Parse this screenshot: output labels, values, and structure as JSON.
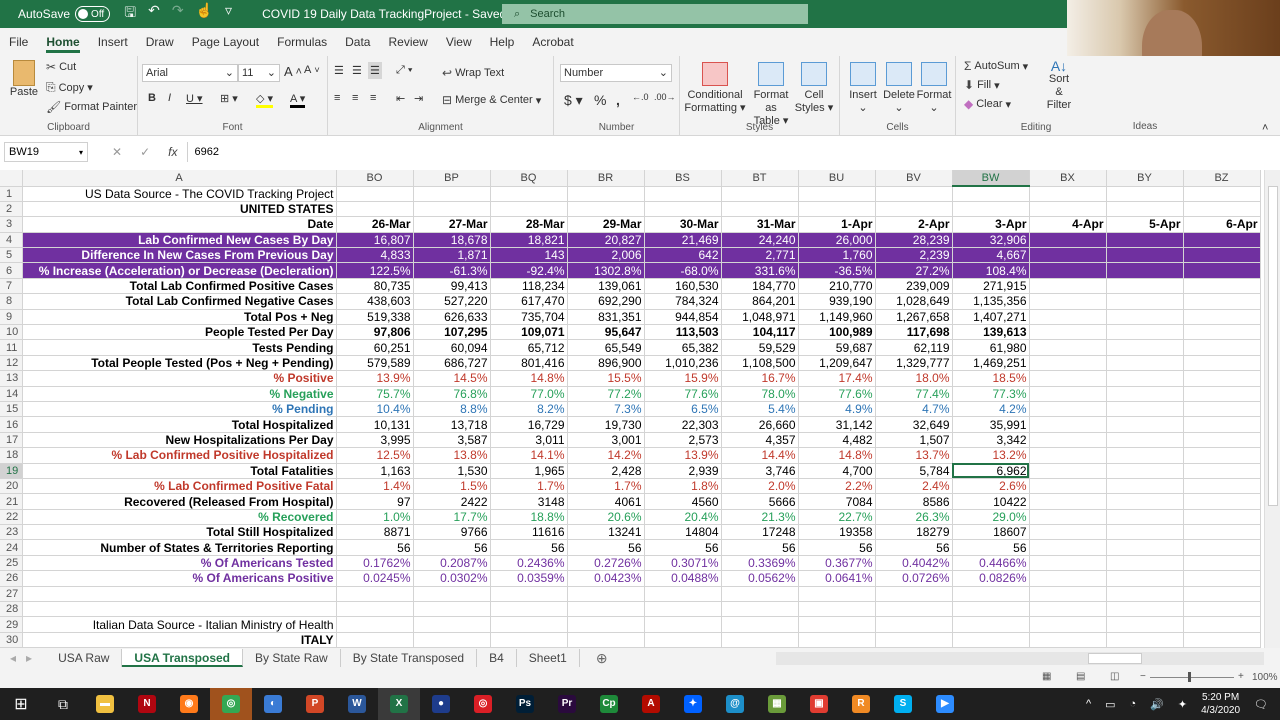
{
  "titlebar": {
    "autosave_label": "AutoSave",
    "autosave_state": "Off",
    "document_title": "COVID 19 Daily Data TrackingProject",
    "save_status": "Saved",
    "search_placeholder": "Search"
  },
  "menu": [
    "File",
    "Home",
    "Insert",
    "Draw",
    "Page Layout",
    "Formulas",
    "Data",
    "Review",
    "View",
    "Help",
    "Acrobat"
  ],
  "menu_active": "Home",
  "ribbon": {
    "clipboard": {
      "paste": "Paste",
      "cut": "Cut",
      "copy": "Copy",
      "format_painter": "Format Painter",
      "label": "Clipboard"
    },
    "font": {
      "name": "Arial",
      "size": "11",
      "label": "Font"
    },
    "alignment": {
      "wrap_text": "Wrap Text",
      "merge_center": "Merge & Center",
      "label": "Alignment"
    },
    "number": {
      "format": "Number",
      "label": "Number"
    },
    "styles": {
      "conditional": "Conditional",
      "conditional2": "Formatting",
      "format_as": "Format as",
      "table": "Table",
      "cell": "Cell",
      "styles": "Styles",
      "label": "Styles"
    },
    "cells": {
      "insert": "Insert",
      "delete": "Delete",
      "format": "Format",
      "label": "Cells"
    },
    "editing": {
      "autosum": "AutoSum",
      "fill": "Fill",
      "clear": "Clear",
      "sort": "Sort &",
      "filter": "Filter",
      "label": "Editing"
    },
    "ideas": {
      "label": "Ideas"
    }
  },
  "formula_bar": {
    "name_box": "BW19",
    "formula": "6962"
  },
  "columns": [
    "A",
    "BO",
    "BP",
    "BQ",
    "BR",
    "BS",
    "BT",
    "BU",
    "BV",
    "BW",
    "BX",
    "BY",
    "BZ"
  ],
  "selected_column": "BW",
  "selected_row": 19,
  "rows": [
    {
      "n": 1,
      "label": "US Data Source - The COVID Tracking Project",
      "style": "plain",
      "values": []
    },
    {
      "n": 2,
      "label": "UNITED STATES",
      "style": "bold",
      "values": []
    },
    {
      "n": 3,
      "label": "Date",
      "style": "bold",
      "values": [
        "26-Mar",
        "27-Mar",
        "28-Mar",
        "29-Mar",
        "30-Mar",
        "31-Mar",
        "1-Apr",
        "2-Apr",
        "3-Apr",
        "4-Apr",
        "5-Apr",
        "6-Apr"
      ]
    },
    {
      "n": 4,
      "label": "Lab Confirmed New Cases By Day",
      "style": "purple",
      "values": [
        "16,807",
        "18,678",
        "18,821",
        "20,827",
        "21,469",
        "24,240",
        "26,000",
        "28,239",
        "32,906",
        "",
        "",
        ""
      ]
    },
    {
      "n": 5,
      "label": "Difference In New Cases From Previous Day",
      "style": "purple",
      "values": [
        "4,833",
        "1,871",
        "143",
        "2,006",
        "642",
        "2,771",
        "1,760",
        "2,239",
        "4,667",
        "",
        "",
        ""
      ]
    },
    {
      "n": 6,
      "label": "% Increase (Acceleration) or Decrease (Decleration)",
      "style": "purple",
      "values": [
        "122.5%",
        "-61.3%",
        "-92.4%",
        "1302.8%",
        "-68.0%",
        "331.6%",
        "-36.5%",
        "27.2%",
        "108.4%",
        "",
        "",
        ""
      ]
    },
    {
      "n": 7,
      "label": "Total Lab Confirmed Positive Cases",
      "style": "black",
      "values": [
        "80,735",
        "99,413",
        "118,234",
        "139,061",
        "160,530",
        "184,770",
        "210,770",
        "239,009",
        "271,915"
      ]
    },
    {
      "n": 8,
      "label": "Total Lab Confirmed Negative Cases",
      "style": "black",
      "values": [
        "438,603",
        "527,220",
        "617,470",
        "692,290",
        "784,324",
        "864,201",
        "939,190",
        "1,028,649",
        "1,135,356"
      ]
    },
    {
      "n": 9,
      "label": "Total Pos + Neg",
      "style": "black",
      "values": [
        "519,338",
        "626,633",
        "735,704",
        "831,351",
        "944,854",
        "1,048,971",
        "1,149,960",
        "1,267,658",
        "1,407,271"
      ]
    },
    {
      "n": 10,
      "label": "People Tested Per Day",
      "style": "boldvals",
      "values": [
        "97,806",
        "107,295",
        "109,071",
        "95,647",
        "113,503",
        "104,117",
        "100,989",
        "117,698",
        "139,613"
      ]
    },
    {
      "n": 11,
      "label": "Tests Pending",
      "style": "black",
      "values": [
        "60,251",
        "60,094",
        "65,712",
        "65,549",
        "65,382",
        "59,529",
        "59,687",
        "62,119",
        "61,980"
      ]
    },
    {
      "n": 12,
      "label": "Total People Tested (Pos + Neg + Pending)",
      "style": "black",
      "values": [
        "579,589",
        "686,727",
        "801,416",
        "896,900",
        "1,010,236",
        "1,108,500",
        "1,209,647",
        "1,329,777",
        "1,469,251"
      ]
    },
    {
      "n": 13,
      "label": "% Positive",
      "style": "red",
      "values": [
        "13.9%",
        "14.5%",
        "14.8%",
        "15.5%",
        "15.9%",
        "16.7%",
        "17.4%",
        "18.0%",
        "18.5%"
      ]
    },
    {
      "n": 14,
      "label": "% Negative",
      "style": "green",
      "values": [
        "75.7%",
        "76.8%",
        "77.0%",
        "77.2%",
        "77.6%",
        "78.0%",
        "77.6%",
        "77.4%",
        "77.3%"
      ]
    },
    {
      "n": 15,
      "label": "% Pending",
      "style": "blue",
      "values": [
        "10.4%",
        "8.8%",
        "8.2%",
        "7.3%",
        "6.5%",
        "5.4%",
        "4.9%",
        "4.7%",
        "4.2%"
      ]
    },
    {
      "n": 16,
      "label": "Total Hospitalized",
      "style": "black",
      "values": [
        "10,131",
        "13,718",
        "16,729",
        "19,730",
        "22,303",
        "26,660",
        "31,142",
        "32,649",
        "35,991"
      ]
    },
    {
      "n": 17,
      "label": "New Hospitalizations Per Day",
      "style": "black",
      "values": [
        "3,995",
        "3,587",
        "3,011",
        "3,001",
        "2,573",
        "4,357",
        "4,482",
        "1,507",
        "3,342"
      ]
    },
    {
      "n": 18,
      "label": "% Lab Confirmed Positive Hospitalized",
      "style": "red",
      "values": [
        "12.5%",
        "13.8%",
        "14.1%",
        "14.2%",
        "13.9%",
        "14.4%",
        "14.8%",
        "13.7%",
        "13.2%"
      ]
    },
    {
      "n": 19,
      "label": "Total Fatalities",
      "style": "black",
      "values": [
        "1,163",
        "1,530",
        "1,965",
        "2,428",
        "2,939",
        "3,746",
        "4,700",
        "5,784",
        "6,962"
      ]
    },
    {
      "n": 20,
      "label": "% Lab Confirmed Positive Fatal",
      "style": "red",
      "values": [
        "1.4%",
        "1.5%",
        "1.7%",
        "1.7%",
        "1.8%",
        "2.0%",
        "2.2%",
        "2.4%",
        "2.6%"
      ]
    },
    {
      "n": 21,
      "label": "Recovered (Released From Hospital)",
      "style": "black",
      "values": [
        "97",
        "2422",
        "3148",
        "4061",
        "4560",
        "5666",
        "7084",
        "8586",
        "10422"
      ]
    },
    {
      "n": 22,
      "label": "% Recovered",
      "style": "green",
      "values": [
        "1.0%",
        "17.7%",
        "18.8%",
        "20.6%",
        "20.4%",
        "21.3%",
        "22.7%",
        "26.3%",
        "29.0%"
      ]
    },
    {
      "n": 23,
      "label": "Total Still Hospitalized",
      "style": "black",
      "values": [
        "8871",
        "9766",
        "11616",
        "13241",
        "14804",
        "17248",
        "19358",
        "18279",
        "18607"
      ]
    },
    {
      "n": 24,
      "label": "Number of States & Territories Reporting",
      "style": "black",
      "values": [
        "56",
        "56",
        "56",
        "56",
        "56",
        "56",
        "56",
        "56",
        "56"
      ]
    },
    {
      "n": 25,
      "label": "% Of Americans Tested",
      "style": "purpletext",
      "values": [
        "0.1762%",
        "0.2087%",
        "0.2436%",
        "0.2726%",
        "0.3071%",
        "0.3369%",
        "0.3677%",
        "0.4042%",
        "0.4466%"
      ]
    },
    {
      "n": 26,
      "label": "% Of Americans Positive",
      "style": "purpletext",
      "values": [
        "0.0245%",
        "0.0302%",
        "0.0359%",
        "0.0423%",
        "0.0488%",
        "0.0562%",
        "0.0641%",
        "0.0726%",
        "0.0826%"
      ]
    },
    {
      "n": 27,
      "label": "",
      "style": "plain",
      "values": []
    },
    {
      "n": 28,
      "label": "",
      "style": "plain",
      "values": []
    },
    {
      "n": 29,
      "label": "Italian Data Source - Italian Ministry of Health",
      "style": "plain",
      "values": []
    },
    {
      "n": 30,
      "label": "ITALY",
      "style": "bold",
      "values": []
    }
  ],
  "sheet_tabs": [
    "USA Raw",
    "USA Transposed",
    "By State Raw",
    "By State Transposed",
    "B4",
    "Sheet1"
  ],
  "active_sheet": "USA Transposed",
  "statusbar": {
    "zoom": "100%"
  },
  "taskbar": {
    "apps": [
      {
        "name": "file-explorer",
        "glyph": "▬",
        "color": "#f0c040"
      },
      {
        "name": "netflix",
        "glyph": "N",
        "color": "#b00610"
      },
      {
        "name": "firefox",
        "glyph": "◉",
        "color": "#ff7a1a"
      },
      {
        "name": "chrome",
        "glyph": "◎",
        "color": "#34a853"
      },
      {
        "name": "browser",
        "glyph": "◐",
        "color": "#3a7bd5"
      },
      {
        "name": "powerpoint",
        "glyph": "P",
        "color": "#d24726"
      },
      {
        "name": "word",
        "glyph": "W",
        "color": "#2b579a"
      },
      {
        "name": "excel",
        "glyph": "X",
        "color": "#217346"
      },
      {
        "name": "app-blue",
        "glyph": "●",
        "color": "#1e3c8c"
      },
      {
        "name": "creative-cloud",
        "glyph": "◎",
        "color": "#da1f26"
      },
      {
        "name": "photoshop",
        "glyph": "Ps",
        "color": "#001e36"
      },
      {
        "name": "premiere",
        "glyph": "Pr",
        "color": "#2a0a3d"
      },
      {
        "name": "captivate",
        "glyph": "Cp",
        "color": "#1e8a3a"
      },
      {
        "name": "acrobat",
        "glyph": "A",
        "color": "#b30b00"
      },
      {
        "name": "dropbox",
        "glyph": "✦",
        "color": "#0061ff"
      },
      {
        "name": "app-cyan",
        "glyph": "@",
        "color": "#1d8fc9"
      },
      {
        "name": "app-multi",
        "glyph": "▦",
        "color": "#6a9b3a"
      },
      {
        "name": "app-red",
        "glyph": "▣",
        "color": "#e03c31"
      },
      {
        "name": "app-r",
        "glyph": "R",
        "color": "#f08a24"
      },
      {
        "name": "skype",
        "glyph": "S",
        "color": "#00aff0"
      },
      {
        "name": "zoom",
        "glyph": "▶",
        "color": "#2d8cff"
      }
    ],
    "time": "5:20 PM",
    "date": "4/3/2020"
  }
}
